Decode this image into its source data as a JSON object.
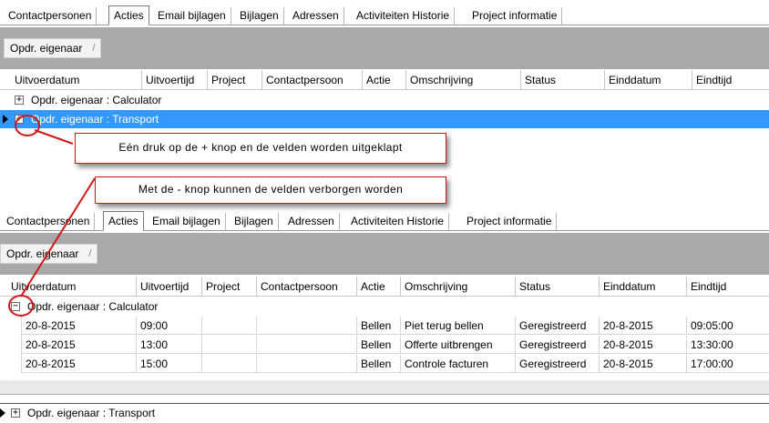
{
  "tabs": [
    "Contactpersonen",
    "Acties",
    "Email bijlagen",
    "Bijlagen",
    "Adressen",
    "Activiteiten Historie",
    "Project informatie"
  ],
  "active_tab": "Acties",
  "group_chip": {
    "label": "Opdr. eigenaar",
    "sort_icon": "/"
  },
  "columns": [
    "Uitvoerdatum",
    "Uitvoertijd",
    "Project",
    "Contactpersoon",
    "Actie",
    "Omschrijving",
    "Status",
    "Einddatum",
    "Eindtijd"
  ],
  "panel1": {
    "groups": [
      {
        "label": "Opdr. eigenaar : Calculator",
        "expander": "+"
      },
      {
        "label": "Opdr. eigenaar : Transport",
        "expander": "+"
      }
    ]
  },
  "panel2": {
    "group_expanded": {
      "label": "Opdr. eigenaar : Calculator",
      "expander": "−"
    },
    "rows": [
      {
        "uitvoerdatum": "20-8-2015",
        "uitvoertijd": "09:00",
        "project": "",
        "contactpersoon": "",
        "actie": "Bellen",
        "omschrijving": "Piet terug bellen",
        "status": "Geregistreerd",
        "einddatum": "20-8-2015",
        "eindtijd": "09:05:00"
      },
      {
        "uitvoerdatum": "20-8-2015",
        "uitvoertijd": "13:00",
        "project": "",
        "contactpersoon": "",
        "actie": "Bellen",
        "omschrijving": "Offerte uitbrengen",
        "status": "Geregistreerd",
        "einddatum": "20-8-2015",
        "eindtijd": "13:30:00"
      },
      {
        "uitvoerdatum": "20-8-2015",
        "uitvoertijd": "15:00",
        "project": "",
        "contactpersoon": "",
        "actie": "Bellen",
        "omschrijving": "Controle facturen",
        "status": "Geregistreerd",
        "einddatum": "20-8-2015",
        "eindtijd": "17:00:00"
      }
    ],
    "group_collapsed": {
      "label": "Opdr. eigenaar : Transport",
      "expander": "+"
    }
  },
  "callouts": {
    "expand": "Eén druk op de + knop en de velden worden uitgeklapt",
    "collapse": "Met de - knop kunnen de velden verborgen worden"
  },
  "colors": {
    "selection": "#3399ff",
    "annotation": "#d01818",
    "group_bar": "#a9a9a9"
  }
}
